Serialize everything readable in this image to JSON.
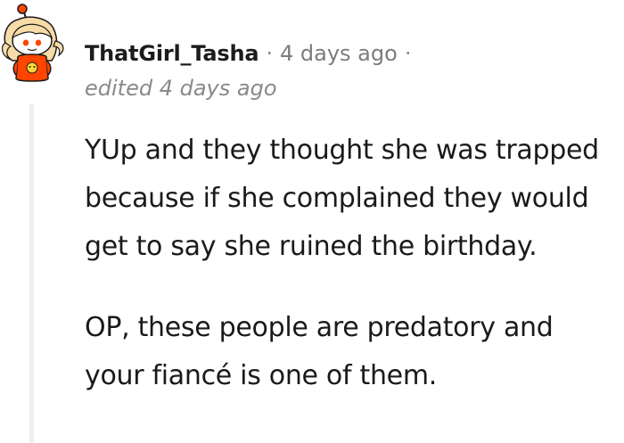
{
  "comment": {
    "author": "ThatGirl_Tasha",
    "separator": "·",
    "timestamp": "4 days ago",
    "edited": "edited 4 days ago",
    "paragraphs": [
      "YUp and they thought she was trapped because if she complained they would get to say she ruined the birthday.",
      "OP, these people are predatory and your fiancé is one of them."
    ]
  },
  "avatar": {
    "icon": "snoo-avatar-icon",
    "skin_color": "#f7dca8",
    "hair_color": "#f7dca8",
    "shirt_color": "#ff4500",
    "antenna_color": "#ff4500"
  },
  "colors": {
    "username": "#1c1c1c",
    "meta": "#7c7c7c",
    "body": "#1a1a1b",
    "thread_line": "#edeff1"
  }
}
